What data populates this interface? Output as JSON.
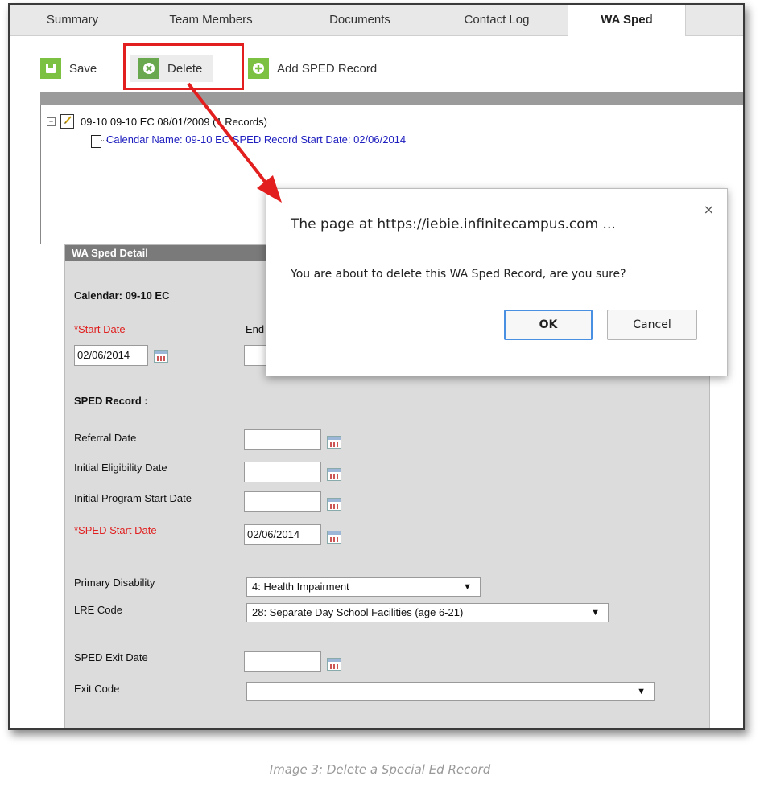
{
  "tabs": [
    "Summary",
    "Team Members",
    "Documents",
    "Contact Log",
    "WA Sped"
  ],
  "toolbar": {
    "save": "Save",
    "delete": "Delete",
    "add": "Add SPED Record"
  },
  "tree": {
    "node": "09-10 09-10 EC 08/01/2009 (1 Records)",
    "child": "Calendar Name: 09-10 EC SPED Record Start Date: 02/06/2014",
    "expander": "−"
  },
  "detail": {
    "header": "WA Sped Detail",
    "calendar": "Calendar: 09-10 EC",
    "start_date_label": "*Start Date",
    "start_date_value": "02/06/2014",
    "end_date_label": "End",
    "sped_record_label": "SPED Record :",
    "referral_label": "Referral Date",
    "initial_elig_label": "Initial Eligibility Date",
    "initial_prog_label": "Initial Program Start Date",
    "sped_start_label": "*SPED Start Date",
    "sped_start_value": "02/06/2014",
    "primary_disability_label": "Primary Disability",
    "primary_disability_value": "4: Health Impairment",
    "lre_label": "LRE Code",
    "lre_value": "28: Separate Day School Facilities (age 6-21)",
    "exit_date_label": "SPED Exit Date",
    "exit_code_label": "Exit Code",
    "exit_code_value": ""
  },
  "dialog": {
    "title": "The page at https://iebie.infinitecampus.com ...",
    "message": "You are about to delete this WA Sped Record, are you sure?",
    "ok": "OK",
    "cancel": "Cancel",
    "close": "×"
  },
  "caption": "Image 3: Delete a Special Ed Record",
  "colors": {
    "highlight": "#e21e1e",
    "required": "#e02020",
    "link": "#2020c0",
    "green": "#7dc142"
  },
  "icons": {
    "save": "save-icon",
    "delete": "delete-icon",
    "add": "add-icon",
    "calendar": "calendar-icon",
    "dropdown": "dropdown-arrow-icon"
  }
}
